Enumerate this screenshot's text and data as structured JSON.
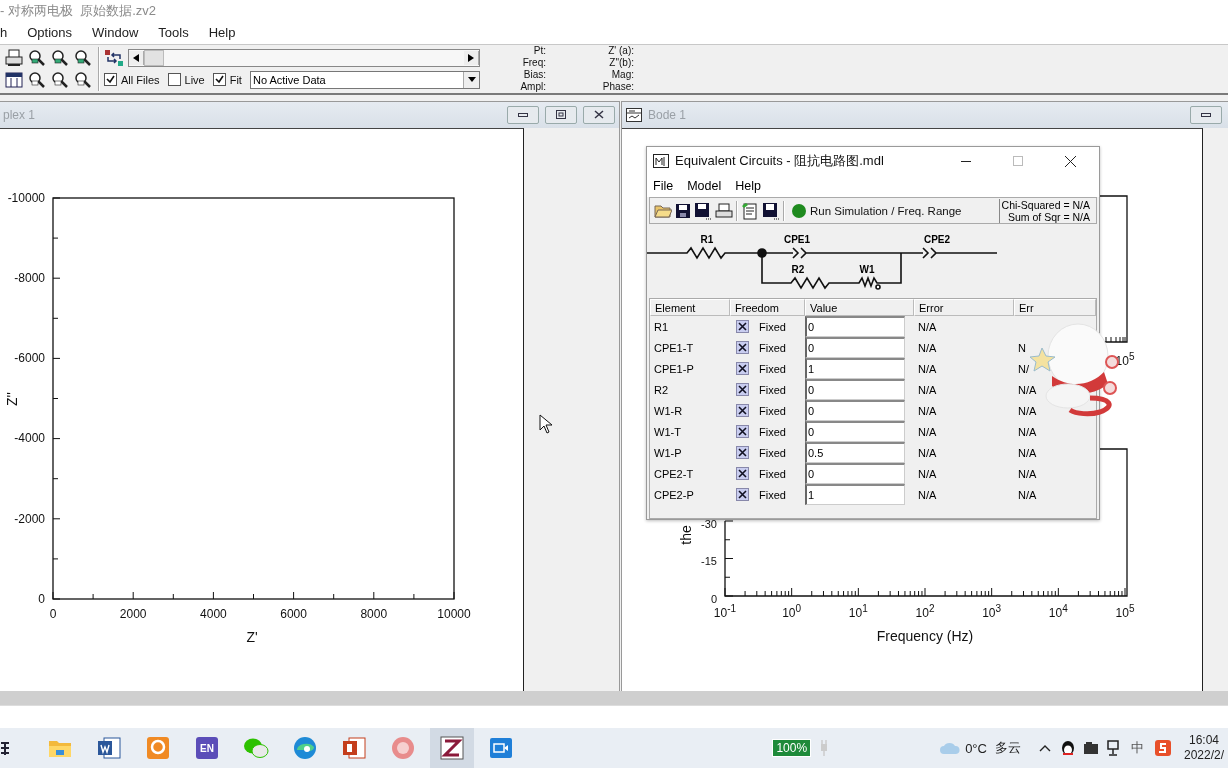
{
  "window": {
    "title": "- 对称两电极  原始数据.zv2"
  },
  "menu": [
    "h",
    "Options",
    "Window",
    "Tools",
    "Help"
  ],
  "toolbar": {
    "files": [
      {
        "label": "All Files",
        "checked": true
      },
      {
        "label": "Live",
        "checked": false
      },
      {
        "label": "Fit",
        "checked": true
      }
    ],
    "data_select": "No Active Data",
    "readouts_left": [
      "Pt:",
      "Freq:",
      "Bias:",
      "Ampl:"
    ],
    "readouts_right": [
      "Z' (a):",
      "Z\"(b):",
      "Mag:",
      "Phase:"
    ]
  },
  "complex_window": {
    "title": "plex 1",
    "chart_data": {
      "type": "scatter",
      "xlabel": "Z'",
      "ylabel": "Z''",
      "xlim": [
        0,
        10000
      ],
      "ylim": [
        0,
        -10000
      ],
      "xticks": [
        0,
        2000,
        4000,
        6000,
        8000,
        10000
      ],
      "yticks": [
        -10000,
        -8000,
        -6000,
        -4000,
        -2000,
        0
      ]
    }
  },
  "bode_window": {
    "title": "Bode 1",
    "upper_plot": {
      "x_tick_label": "10$^{5}$"
    },
    "lower_chart": {
      "chart_data": {
        "type": "line",
        "xlabel": "Frequency (Hz)",
        "ylabel": "the",
        "ylim": [
          0,
          -30
        ],
        "yticks": [
          -30,
          -15,
          0
        ],
        "categories": [
          "10$^{-1}$",
          "10$^{0}$",
          "10$^{1}$",
          "10$^{2}$",
          "10$^{3}$",
          "10$^{4}$",
          "10$^{5}$"
        ]
      }
    }
  },
  "dialog": {
    "title": "Equivalent Circuits - 阻抗电路图.mdl",
    "menu": [
      "File",
      "Model",
      "Help"
    ],
    "run_button": "Run Simulation / Freq. Range",
    "chi_squared": "Chi-Squared = N/A",
    "sum_of_squares": "Sum of Sqr = N/A",
    "circuit_labels": [
      "R1",
      "CPE1",
      "CPE2",
      "R2",
      "W1"
    ],
    "columns": [
      "Element",
      "Freedom",
      "Value",
      "Error",
      "Err"
    ],
    "rows": [
      {
        "element": "R1",
        "fixed": true,
        "freedom": "Fixed",
        "value": "0",
        "error": "N/A"
      },
      {
        "element": "CPE1-T",
        "fixed": true,
        "freedom": "Fixed",
        "value": "0",
        "error": "N/A",
        "error_2": "N"
      },
      {
        "element": "CPE1-P",
        "fixed": true,
        "freedom": "Fixed",
        "value": "1",
        "error": "N/A",
        "error_2": "N/"
      },
      {
        "element": "R2",
        "fixed": true,
        "freedom": "Fixed",
        "value": "0",
        "error": "N/A",
        "error_2": "N/A"
      },
      {
        "element": "W1-R",
        "fixed": true,
        "freedom": "Fixed",
        "value": "0",
        "error": "N/A",
        "error_2": "N/A"
      },
      {
        "element": "W1-T",
        "fixed": true,
        "freedom": "Fixed",
        "value": "0",
        "error": "N/A",
        "error_2": "N/A"
      },
      {
        "element": "W1-P",
        "fixed": true,
        "freedom": "Fixed",
        "value": "0.5",
        "error": "N/A",
        "error_2": "N/A"
      },
      {
        "element": "CPE2-T",
        "fixed": true,
        "freedom": "Fixed",
        "value": "0",
        "error": "N/A",
        "error_2": "N/A"
      },
      {
        "element": "CPE2-P",
        "fixed": true,
        "freedom": "Fixed",
        "value": "1",
        "error": "N/A",
        "error_2": "N/A"
      }
    ]
  },
  "taskbar": {
    "apps": [
      {
        "kind": "start",
        "selected": false
      },
      {
        "kind": "folder",
        "selected": false
      },
      {
        "kind": "word",
        "selected": false
      },
      {
        "kind": "pdf",
        "selected": false
      },
      {
        "kind": "en",
        "label": "EN",
        "selected": false
      },
      {
        "kind": "chat",
        "selected": false
      },
      {
        "kind": "browser",
        "selected": false
      },
      {
        "kind": "slides",
        "selected": false
      },
      {
        "kind": "ball",
        "selected": false
      },
      {
        "kind": "zview",
        "selected": true
      },
      {
        "kind": "video",
        "selected": false
      }
    ],
    "battery": "100%",
    "temperature": "0°C",
    "weather": "多云",
    "ime": "中",
    "time": "16:04",
    "date": "2022/2/"
  }
}
